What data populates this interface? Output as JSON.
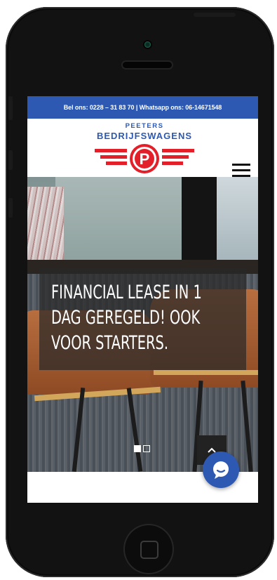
{
  "topbar": {
    "contact_text": "Bel ons: 0228 – 31 83 70 | Whatsapp ons: 06-14671548"
  },
  "logo": {
    "line1": "PEETERS",
    "line2": "BEDRIJFSWAGENS",
    "mark_letter": "P"
  },
  "hero": {
    "caption_line1": "FINANCIAL LEASE IN 1",
    "caption_line2": "DAG GEREGELD! OOK",
    "caption_line3": "VOOR STARTERS."
  },
  "slider": {
    "slides": 2,
    "active_slide": 1
  },
  "colors": {
    "brand_blue": "#2e59b2",
    "brand_red": "#e3202a"
  },
  "icons": {
    "menu": "hamburger-icon",
    "scroll_top": "chevron-up-icon",
    "chat": "chat-bubble-icon"
  }
}
